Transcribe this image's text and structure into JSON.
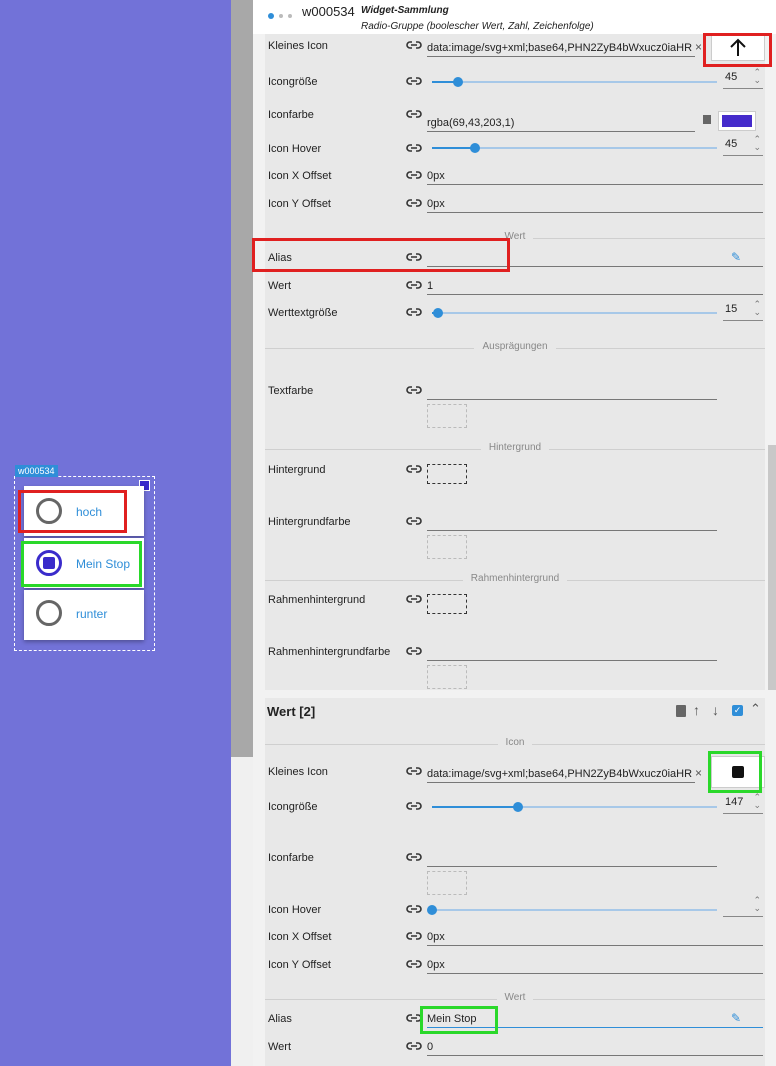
{
  "header": {
    "widget_id": "w000534",
    "widget_set": "Widget-Sammlung",
    "widget_type": "Radio-Gruppe (boolescher Wert, Zahl, Zeichenfolge)"
  },
  "preview": {
    "widget_tag": "w000534",
    "options": [
      {
        "label": "hoch",
        "selected": false
      },
      {
        "label": "Mein Stop",
        "selected": true
      },
      {
        "label": "runter",
        "selected": false
      }
    ]
  },
  "wert1": {
    "small_icon_label": "Kleines Icon",
    "small_icon_value": "data:image/svg+xml;base64,PHN2ZyB4bWxucz0iaHR",
    "icon_size_label": "Icongröße",
    "icon_size_value": "45",
    "icon_size_fraction": 0.09,
    "icon_color_label": "Iconfarbe",
    "icon_color_value": "rgba(69,43,203,1)",
    "icon_color_swatch": "#452bcb",
    "icon_hover_label": "Icon Hover",
    "icon_hover_value": "45",
    "icon_hover_fraction": 0.15,
    "icon_x_label": "Icon X Offset",
    "icon_x_value": "0px",
    "icon_y_label": "Icon Y Offset",
    "icon_y_value": "0px",
    "sect_wert": "Wert",
    "alias_label": "Alias",
    "alias_value": "",
    "wert_label": "Wert",
    "wert_value": "1",
    "werttext_label": "Werttextgröße",
    "werttext_value": "15",
    "werttext_fraction": 0.02,
    "sect_auspraegungen": "Ausprägungen",
    "textfarbe_label": "Textfarbe",
    "sect_hintergrund": "Hintergrund",
    "hintergrund_label": "Hintergrund",
    "hintergrundfarbe_label": "Hintergrundfarbe",
    "sect_rahmen": "Rahmenhintergrund",
    "rahmen_label": "Rahmenhintergrund",
    "rahmenfarbe_label": "Rahmenhintergrundfarbe"
  },
  "wert2": {
    "title": "Wert [2]",
    "sect_icon": "Icon",
    "small_icon_label": "Kleines Icon",
    "small_icon_value": "data:image/svg+xml;base64,PHN2ZyB4bWxucz0iaHR",
    "icon_size_label": "Icongröße",
    "icon_size_value": "147",
    "icon_size_fraction": 0.3,
    "icon_color_label": "Iconfarbe",
    "icon_hover_label": "Icon Hover",
    "icon_x_label": "Icon X Offset",
    "icon_x_value": "0px",
    "icon_y_label": "Icon Y Offset",
    "icon_y_value": "0px",
    "sect_wert": "Wert",
    "alias_label": "Alias",
    "alias_value": "Mein Stop",
    "wert_label": "Wert",
    "wert_value": "0"
  },
  "colors": {
    "canvas": "#7272d8",
    "accent": "#2f8ed8",
    "highlight_red": "#e02020",
    "highlight_green": "#2ad82a"
  }
}
